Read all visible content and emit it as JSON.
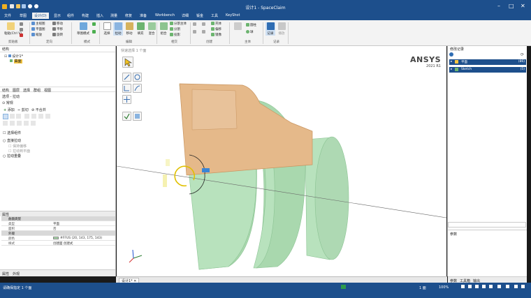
{
  "window": {
    "title": "设计1 - SpaceClaim"
  },
  "menu": {
    "items": [
      "文件",
      "草图",
      "设计(D)",
      "显示",
      "组件",
      "构建",
      "插入",
      "测量",
      "修复",
      "准备",
      "Workbench",
      "详细",
      "钣金",
      "工具",
      "KeyShot"
    ],
    "active_index": 2
  },
  "ribbon": {
    "groups": [
      {
        "label": "剪贴板"
      },
      {
        "label": "定向"
      },
      {
        "label": "模式"
      },
      {
        "label": "编辑"
      },
      {
        "label": "相交"
      },
      {
        "label": "创建"
      },
      {
        "label": "主体"
      },
      {
        "label": "记录"
      }
    ],
    "paste_label": "粘贴(Ctrl V)",
    "orient_items": [
      "主视图",
      "平面图",
      "缩放"
    ],
    "orient_items2": [
      "移动",
      "平移",
      "旋转"
    ],
    "sketch_mode_label": "草图模式",
    "select_label": "选择",
    "pull_label": "拉动",
    "move_label": "移动",
    "fill_label": "填充",
    "blend_label": "混合",
    "combine_label": "组合",
    "split_body_label": "分割主体",
    "split_label": "分割",
    "projection_label": "投影",
    "create_items": [
      "壳体",
      "偏移",
      "镜像"
    ],
    "body_items": [
      "圆柱",
      "球"
    ],
    "record_label": "记录",
    "replay_label": "播放"
  },
  "structure": {
    "title": "结构",
    "tree_root": "设计1*",
    "tree_child": "曲面"
  },
  "left_tabs": [
    "结构",
    "图层",
    "选择",
    "群组",
    "视图"
  ],
  "options": {
    "title": "选项 - 拉动",
    "section": "常规",
    "add_label": "添加",
    "cut_label": "剪切",
    "no_merge_label": "不合并",
    "select_group_label": "选择组件",
    "option1": "直接拉动",
    "option2": "保持偏移",
    "option3": "拉动到平面",
    "option4": "拉动重叠"
  },
  "properties": {
    "title": "属性",
    "rows": [
      {
        "key": "曲面类型",
        "value": "",
        "header": true
      },
      {
        "key": "类型",
        "value": "平面"
      },
      {
        "key": "面积",
        "value": "否"
      },
      {
        "key": "外观",
        "value": "",
        "header": true
      },
      {
        "key": "颜色",
        "value": "#FFUS (20, 143, 175, 143)"
      },
      {
        "key": "样式",
        "value": "创建面 创建式"
      }
    ],
    "color_swatch": "#a6d8a8"
  },
  "bottom_left_tabs": [
    "属性",
    "外观"
  ],
  "viewport": {
    "header": "快速选择 1 个面",
    "ansys_logo": "ANSYS",
    "ansys_version": "2021 R1",
    "tab_label": "设计1*"
  },
  "selection_panel": {
    "title": "修改记录",
    "rows": [
      {
        "label": "平面",
        "badge": "(86)"
      },
      {
        "label": "Sketch",
        "badge": "(5)"
      }
    ]
  },
  "params_panel": {
    "title": "参数"
  },
  "right_bottom_tabs": [
    "参数",
    "工具箱",
    "输出"
  ],
  "status": {
    "left": "请确保指定 1 个面",
    "mid": "1 面",
    "zoom": "100%"
  },
  "colors": {
    "title_blue": "#1d4f8c",
    "solid_green": "#b8e2bd",
    "solid_green_dark": "#8bc393",
    "orange_face": "#e5b98a",
    "accent_blue": "#3a85d6"
  }
}
